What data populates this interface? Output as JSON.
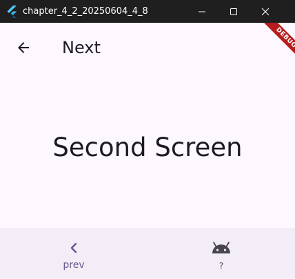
{
  "window": {
    "title": "chapter_4_2_20250604_4_8",
    "icon": "flutter-icon",
    "controls": [
      "minimize-icon",
      "maximize-icon",
      "close-icon"
    ]
  },
  "appbar": {
    "title": "Next",
    "back_icon": "arrow-back-icon"
  },
  "debug_banner": {
    "label": "DEBUG",
    "color": "#b71c1c"
  },
  "body": {
    "text": "Second Screen"
  },
  "bottom_nav": {
    "items": [
      {
        "label": "prev",
        "icon": "chevron-left-icon",
        "selected": true
      },
      {
        "label": "?",
        "icon": "android-icon",
        "selected": false
      }
    ],
    "selected_color": "#65558f"
  },
  "colors": {
    "background": "#fdf7ff",
    "nav_background": "#f3edf7",
    "titlebar": "#1f1f1f"
  }
}
